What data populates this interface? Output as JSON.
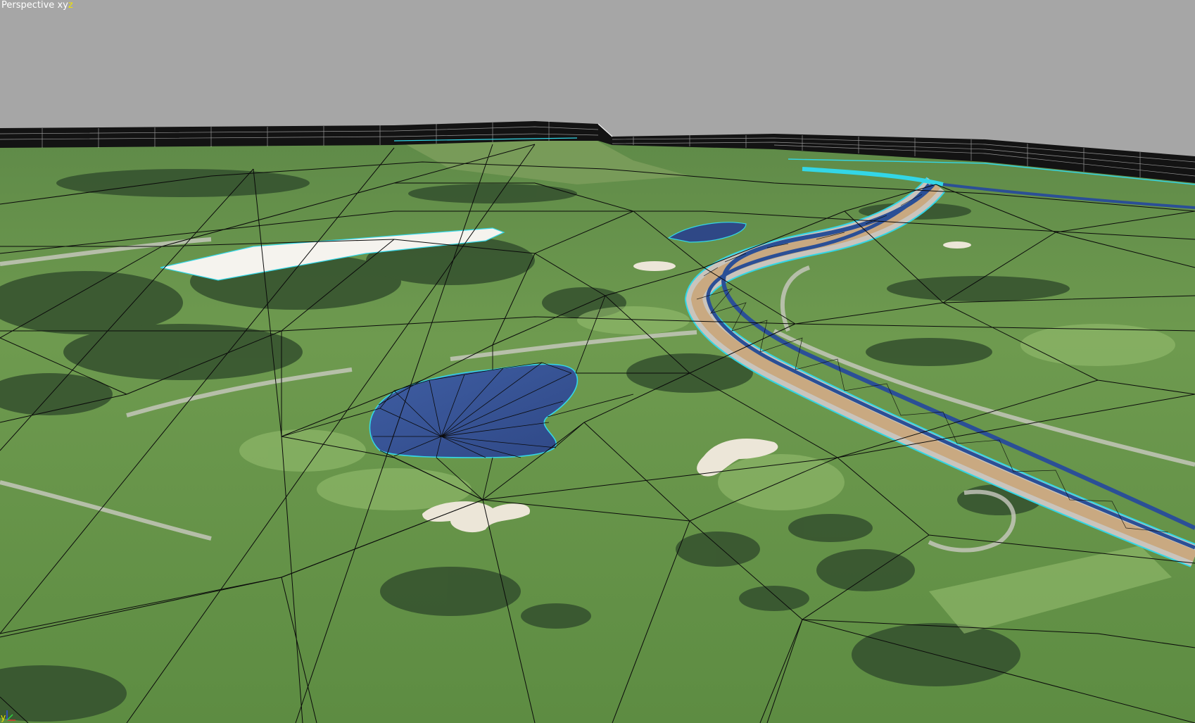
{
  "viewport": {
    "view_name": "Perspective",
    "axis_prefix": "xy",
    "axis_suffix": "z",
    "background_color": "#a6a6a6"
  },
  "gizmo": {
    "y_label": "y"
  },
  "colors": {
    "terrain_light": "#7ea85a",
    "terrain_dark": "#4f7a3c",
    "tree_dark": "#2f4a2c",
    "water": "#3a5596",
    "road_tan": "#c9a981",
    "road_blue": "#2b4f96",
    "highlight_cyan": "#33d6e6",
    "sand": "#ece6d8",
    "wire": "#0a0a0a"
  },
  "icons": {
    "axis_gizmo": "axis-gizmo-icon"
  }
}
